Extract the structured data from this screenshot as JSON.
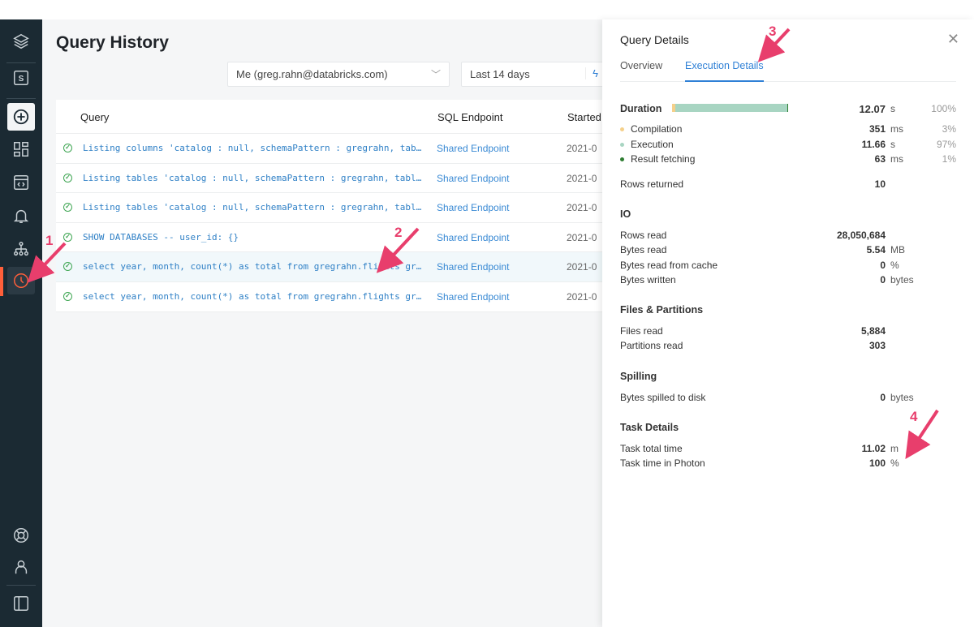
{
  "sidebar": {
    "items": [
      {
        "name": "logo",
        "icon": "layers-icon"
      },
      {
        "name": "sql-persona",
        "icon": "s-box-icon",
        "label": "S"
      },
      {
        "name": "create",
        "icon": "plus-circle-icon"
      },
      {
        "name": "dashboards",
        "icon": "dashboard-icon"
      },
      {
        "name": "queries",
        "icon": "code-window-icon"
      },
      {
        "name": "alerts",
        "icon": "bell-icon"
      },
      {
        "name": "endpoints",
        "icon": "hierarchy-icon"
      },
      {
        "name": "history",
        "icon": "clock-icon",
        "active": true
      },
      {
        "name": "help",
        "icon": "lifebuoy-icon"
      },
      {
        "name": "account",
        "icon": "user-icon"
      },
      {
        "name": "collapse",
        "icon": "sidebar-panel-icon"
      }
    ],
    "accent": "#ff5f3a"
  },
  "main": {
    "title": "Query History",
    "filters": {
      "user": "Me (greg.rahn@databricks.com)",
      "range": "Last 14 days"
    },
    "columns": [
      "Query",
      "SQL Endpoint",
      "Started"
    ],
    "rows": [
      {
        "query": "Listing columns 'catalog : null, schemaPattern : gregrahn, tabl…",
        "endpoint": "Shared Endpoint",
        "started": "2021-0"
      },
      {
        "query": "Listing tables 'catalog : null, schemaPattern : gregrahn, table…",
        "endpoint": "Shared Endpoint",
        "started": "2021-0"
      },
      {
        "query": "Listing tables 'catalog : null, schemaPattern : gregrahn, table…",
        "endpoint": "Shared Endpoint",
        "started": "2021-0"
      },
      {
        "query": "SHOW DATABASES -- user_id: {}",
        "endpoint": "Shared Endpoint",
        "started": "2021-0"
      },
      {
        "query": "select year, month, count(*) as total from gregrahn.flights gro…",
        "endpoint": "Shared Endpoint",
        "started": "2021-0"
      },
      {
        "query": "select year, month, count(*) as total from gregrahn.flights gro…",
        "endpoint": "Shared Endpoint",
        "started": "2021-0"
      }
    ]
  },
  "panel": {
    "title": "Query Details",
    "tabs": [
      "Overview",
      "Execution Details"
    ],
    "active_tab": "Execution Details",
    "duration": {
      "label": "Duration",
      "value": "12.07",
      "unit": "s",
      "pct": "100%"
    },
    "breakdown": [
      {
        "label": "Compilation",
        "value": "351",
        "unit": "ms",
        "pct": "3%",
        "color": "#f5d08a"
      },
      {
        "label": "Execution",
        "value": "11.66",
        "unit": "s",
        "pct": "97%",
        "color": "#a8d5c2"
      },
      {
        "label": "Result fetching",
        "value": "63",
        "unit": "ms",
        "pct": "1%",
        "color": "#2e7d32"
      }
    ],
    "rows_returned": {
      "label": "Rows returned",
      "value": "10"
    },
    "sections": [
      {
        "title": "IO",
        "rows": [
          {
            "label": "Rows read",
            "value": "28,050,684",
            "unit": ""
          },
          {
            "label": "Bytes read",
            "value": "5.54",
            "unit": "MB"
          },
          {
            "label": "Bytes read from cache",
            "value": "0",
            "unit": "%"
          },
          {
            "label": "Bytes written",
            "value": "0",
            "unit": "bytes"
          }
        ]
      },
      {
        "title": "Files & Partitions",
        "rows": [
          {
            "label": "Files read",
            "value": "5,884",
            "unit": ""
          },
          {
            "label": "Partitions read",
            "value": "303",
            "unit": ""
          }
        ]
      },
      {
        "title": "Spilling",
        "rows": [
          {
            "label": "Bytes spilled to disk",
            "value": "0",
            "unit": "bytes"
          }
        ]
      },
      {
        "title": "Task Details",
        "rows": [
          {
            "label": "Task total time",
            "value": "11.02",
            "unit": "m"
          },
          {
            "label": "Task time in Photon",
            "value": "100",
            "unit": "%"
          }
        ]
      }
    ]
  },
  "annotations": [
    "1",
    "2",
    "3",
    "4"
  ]
}
